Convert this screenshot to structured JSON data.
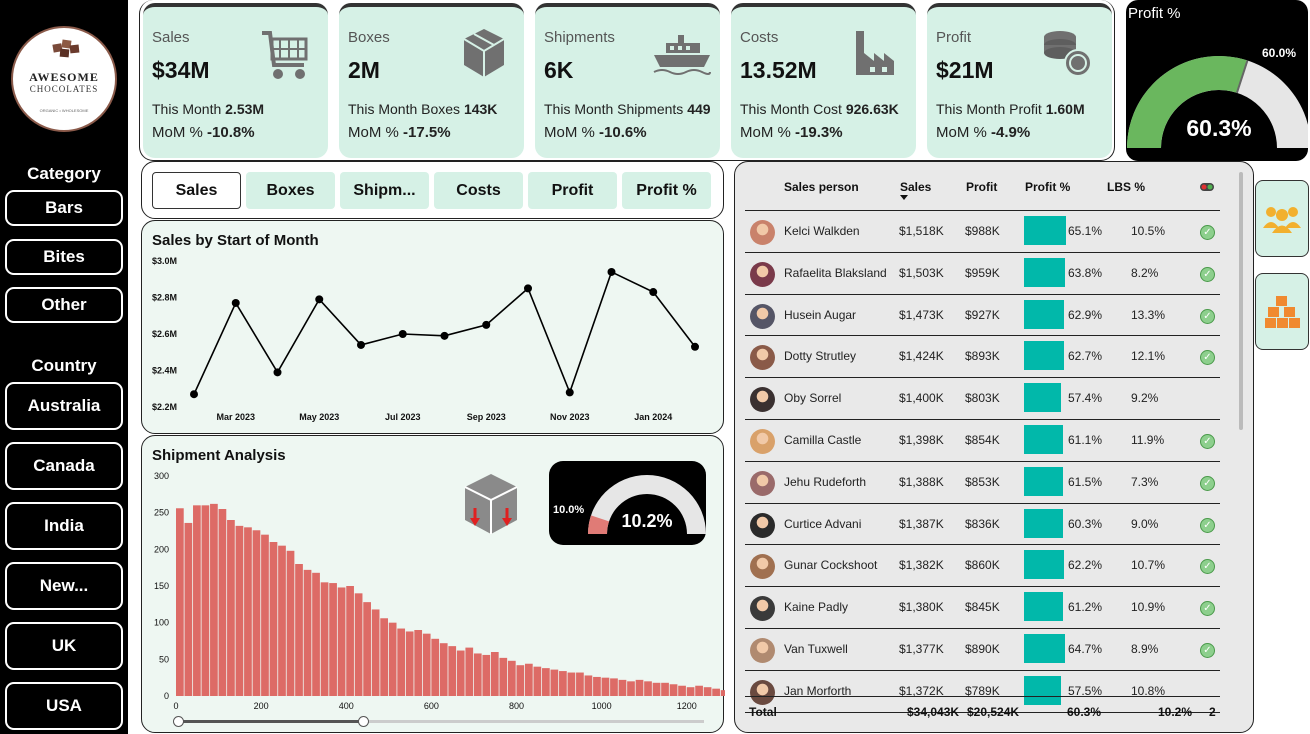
{
  "logo": {
    "line1": "AWESOME",
    "line2": "CHOCOLATES",
    "line3": "ORGANIC • WHOLESOME"
  },
  "sidebar": {
    "category_title": "Category",
    "categories": [
      "Bars",
      "Bites",
      "Other"
    ],
    "country_title": "Country",
    "countries": [
      "Australia",
      "Canada",
      "India",
      "New...",
      "UK",
      "USA"
    ]
  },
  "kpis": [
    {
      "label": "Sales",
      "value": "$34M",
      "month_label": "This Month",
      "month_value": "2.53M",
      "mom_label": "MoM %",
      "mom_value": "-10.8%",
      "icon": "cart-icon"
    },
    {
      "label": "Boxes",
      "value": "2M",
      "month_label": "This Month Boxes",
      "month_value": "143K",
      "mom_label": "MoM %",
      "mom_value": "-17.5%",
      "icon": "box-icon"
    },
    {
      "label": "Shipments",
      "value": "6K",
      "month_label": "This Month Shipments",
      "month_value": "449",
      "mom_label": "MoM %",
      "mom_value": "-10.6%",
      "icon": "ship-icon"
    },
    {
      "label": "Costs",
      "value": "13.52M",
      "month_label": "This Month Cost",
      "month_value": "926.63K",
      "mom_label": "MoM %",
      "mom_value": "-19.3%",
      "icon": "factory-icon"
    },
    {
      "label": "Profit",
      "value": "$21M",
      "month_label": "This Month Profit",
      "month_value": "1.60M",
      "mom_label": "MoM %",
      "mom_value": "-4.9%",
      "icon": "coins-icon"
    }
  ],
  "profit_gauge": {
    "title": "Profit %",
    "value_text": "60.3%",
    "target_text": "60.0%",
    "value": 0.603,
    "target": 0.6,
    "fill_color": "#6ab75e",
    "track_color": "#e6e6e6"
  },
  "tabs": [
    "Sales",
    "Boxes",
    "Shipm...",
    "Costs",
    "Profit",
    "Profit %"
  ],
  "active_tab": 0,
  "line_chart": {
    "title": "Sales by Start of Month"
  },
  "bar_chart": {
    "title": "Shipment Analysis"
  },
  "ship_gauge": {
    "value_text": "10.2%",
    "target_text": "10.0%",
    "value": 0.102,
    "target": 0.1,
    "fill_color": "#e07b76",
    "track_color": "#e6e6e6"
  },
  "chart_data": [
    {
      "type": "line",
      "title": "Sales by Start of Month",
      "x": [
        "2023-02",
        "2023-03",
        "2023-04",
        "2023-05",
        "2023-06",
        "2023-07",
        "2023-08",
        "2023-09",
        "2023-10",
        "2023-11",
        "2023-12",
        "2024-01",
        "2024-02"
      ],
      "values": [
        2.27,
        2.77,
        2.39,
        2.79,
        2.54,
        2.6,
        2.59,
        2.65,
        2.85,
        2.28,
        2.94,
        2.83,
        2.53
      ],
      "x_tick_labels": [
        "Mar 2023",
        "May 2023",
        "Jul 2023",
        "Sep 2023",
        "Nov 2023",
        "Jan 2024"
      ],
      "x_tick_index": [
        1,
        3,
        5,
        7,
        9,
        11
      ],
      "y_ticks": [
        "$2.2M",
        "$2.4M",
        "$2.6M",
        "$2.8M",
        "$3.0M"
      ],
      "ylim": [
        2.2,
        3.0
      ],
      "xlabel": "",
      "ylabel": "",
      "color": "#000000"
    },
    {
      "type": "bar",
      "title": "Shipment Analysis",
      "xlim": [
        0,
        1250
      ],
      "ylim": [
        0,
        300
      ],
      "x_ticks": [
        0,
        200,
        400,
        600,
        800,
        1000,
        1200
      ],
      "y_ticks": [
        0,
        50,
        100,
        150,
        200,
        250,
        300
      ],
      "bin_width": 20,
      "values": [
        256,
        236,
        260,
        260,
        262,
        255,
        240,
        232,
        230,
        226,
        220,
        210,
        205,
        198,
        180,
        172,
        168,
        155,
        154,
        148,
        150,
        140,
        128,
        118,
        106,
        100,
        92,
        88,
        90,
        85,
        78,
        72,
        68,
        62,
        66,
        58,
        56,
        60,
        52,
        48,
        42,
        44,
        40,
        38,
        36,
        34,
        32,
        32,
        28,
        26,
        25,
        24,
        22,
        20,
        22,
        20,
        18,
        18,
        16,
        14,
        12,
        14,
        12,
        10,
        8,
        10,
        8
      ],
      "color": "#dd6b66",
      "xlabel": "",
      "ylabel": ""
    }
  ],
  "table": {
    "headers": {
      "person": "Sales person",
      "sales": "Sales",
      "profit": "Profit",
      "profit_pct": "Profit %",
      "lbs_pct": "LBS %"
    },
    "rows": [
      {
        "name": "Kelci Walkden",
        "sales": "$1,518K",
        "profit": "$988K",
        "pct": "65.1%",
        "pct_v": 0.651,
        "lbs": "10.5%",
        "ok": true,
        "av": "#c9826b"
      },
      {
        "name": "Rafaelita Blaksland",
        "sales": "$1,503K",
        "profit": "$959K",
        "pct": "63.8%",
        "pct_v": 0.638,
        "lbs": "8.2%",
        "ok": true,
        "av": "#7a3a4a"
      },
      {
        "name": "Husein Augar",
        "sales": "$1,473K",
        "profit": "$927K",
        "pct": "62.9%",
        "pct_v": 0.629,
        "lbs": "13.3%",
        "ok": true,
        "av": "#555566"
      },
      {
        "name": "Dotty Strutley",
        "sales": "$1,424K",
        "profit": "$893K",
        "pct": "62.7%",
        "pct_v": 0.627,
        "lbs": "12.1%",
        "ok": true,
        "av": "#8a5a48"
      },
      {
        "name": "Oby Sorrel",
        "sales": "$1,400K",
        "profit": "$803K",
        "pct": "57.4%",
        "pct_v": 0.574,
        "lbs": "9.2%",
        "ok": false,
        "av": "#3a3030"
      },
      {
        "name": "Camilla Castle",
        "sales": "$1,398K",
        "profit": "$854K",
        "pct": "61.1%",
        "pct_v": 0.611,
        "lbs": "11.9%",
        "ok": true,
        "av": "#d9a16a"
      },
      {
        "name": "Jehu Rudeforth",
        "sales": "$1,388K",
        "profit": "$853K",
        "pct": "61.5%",
        "pct_v": 0.615,
        "lbs": "7.3%",
        "ok": true,
        "av": "#9a6a6a"
      },
      {
        "name": "Curtice Advani",
        "sales": "$1,387K",
        "profit": "$836K",
        "pct": "60.3%",
        "pct_v": 0.603,
        "lbs": "9.0%",
        "ok": true,
        "av": "#2a2a2a"
      },
      {
        "name": "Gunar Cockshoot",
        "sales": "$1,382K",
        "profit": "$860K",
        "pct": "62.2%",
        "pct_v": 0.622,
        "lbs": "10.7%",
        "ok": true,
        "av": "#a07050"
      },
      {
        "name": "Kaine Padly",
        "sales": "$1,380K",
        "profit": "$845K",
        "pct": "61.2%",
        "pct_v": 0.612,
        "lbs": "10.9%",
        "ok": true,
        "av": "#3a3a3a"
      },
      {
        "name": "Van Tuxwell",
        "sales": "$1,377K",
        "profit": "$890K",
        "pct": "64.7%",
        "pct_v": 0.647,
        "lbs": "8.9%",
        "ok": true,
        "av": "#b08a70"
      },
      {
        "name": "Jan Morforth",
        "sales": "$1,372K",
        "profit": "$789K",
        "pct": "57.5%",
        "pct_v": 0.575,
        "lbs": "10.8%",
        "ok": false,
        "av": "#6a4a40"
      }
    ],
    "total": {
      "label": "Total",
      "sales": "$34,043K",
      "profit": "$20,524K",
      "pct": "60.3%",
      "lbs": "10.2%",
      "count": "2"
    }
  },
  "side_buttons": [
    "people-icon",
    "boxes-icon"
  ]
}
